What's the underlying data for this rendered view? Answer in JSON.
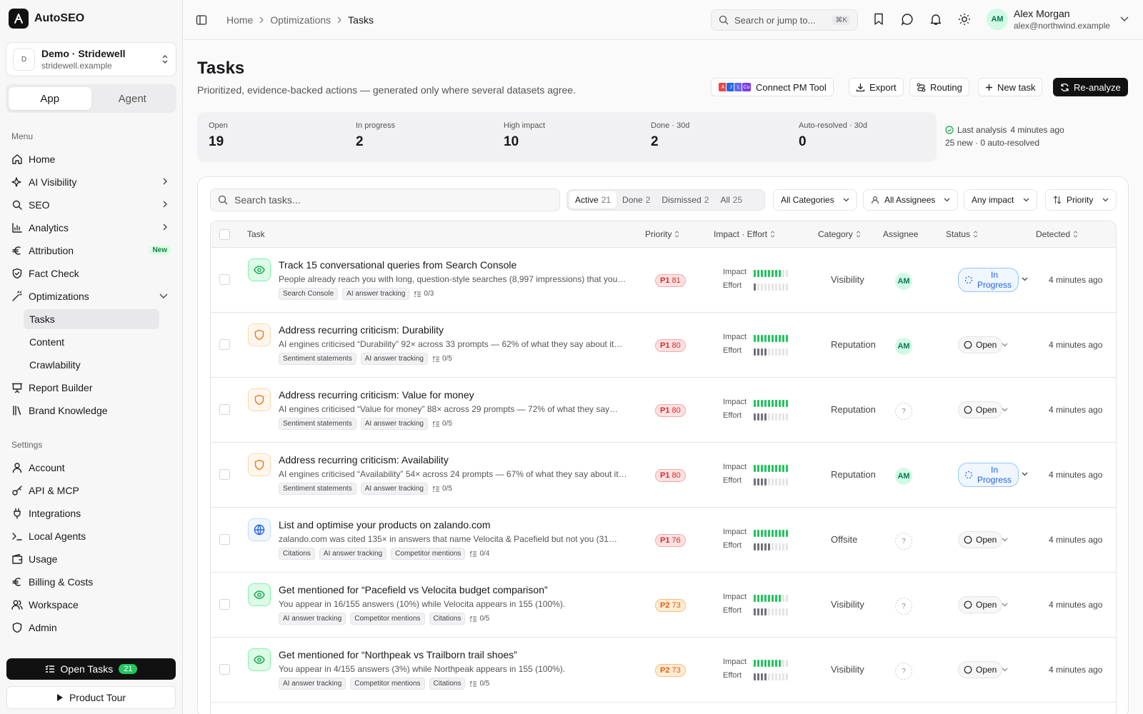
{
  "app": {
    "name": "AutoSEO"
  },
  "workspace": {
    "initial": "D",
    "name": "Demo · Stridewell",
    "domain": "stridewell.example"
  },
  "mode_tabs": {
    "app": "App",
    "agent": "Agent"
  },
  "sidebar": {
    "menu_label": "Menu",
    "items": [
      {
        "label": "Home",
        "icon": "home-icon"
      },
      {
        "label": "AI Visibility",
        "icon": "sparkles-icon",
        "chevron": true
      },
      {
        "label": "SEO",
        "icon": "search-icon",
        "chevron": true
      },
      {
        "label": "Analytics",
        "icon": "bar-chart-icon",
        "chevron": true
      },
      {
        "label": "Attribution",
        "icon": "euro-icon",
        "badge": "New"
      },
      {
        "label": "Fact Check",
        "icon": "shield-check-icon"
      },
      {
        "label": "Optimizations",
        "icon": "magic-wand-icon",
        "expanded": true
      }
    ],
    "sub_items": [
      "Tasks",
      "Content",
      "Crawlability"
    ],
    "items2": [
      {
        "label": "Report Builder",
        "icon": "presentation-icon"
      },
      {
        "label": "Brand Knowledge",
        "icon": "library-icon"
      }
    ],
    "settings_label": "Settings",
    "settings": [
      {
        "label": "Account",
        "icon": "user-icon"
      },
      {
        "label": "API & MCP",
        "icon": "key-icon"
      },
      {
        "label": "Integrations",
        "icon": "plug-icon"
      },
      {
        "label": "Local Agents",
        "icon": "terminal-icon"
      },
      {
        "label": "Usage",
        "icon": "wallet-icon"
      },
      {
        "label": "Billing & Costs",
        "icon": "euro-icon"
      },
      {
        "label": "Workspace",
        "icon": "users-icon"
      },
      {
        "label": "Admin",
        "icon": "shield-icon"
      }
    ],
    "open_tasks": {
      "label": "Open Tasks",
      "count": "21"
    },
    "product_tour": "Product Tour"
  },
  "topbar": {
    "breadcrumb": [
      "Home",
      "Optimizations",
      "Tasks"
    ],
    "search_placeholder": "Search or jump to...",
    "shortcut": "⌘K",
    "user": {
      "initials": "AM",
      "name": "Alex Morgan",
      "email": "alex@northwind.example"
    }
  },
  "page": {
    "title": "Tasks",
    "subtitle": "Prioritized, evidence-backed actions — generated only where several datasets agree.",
    "actions": {
      "connect": "Connect PM Tool",
      "export": "Export",
      "routing": "Routing",
      "new_task": "New task",
      "reanalyze": "Re-analyze"
    },
    "pm_tools": [
      "A",
      "J",
      "L",
      "Cu"
    ]
  },
  "stats": [
    {
      "label": "Open",
      "value": "19"
    },
    {
      "label": "In progress",
      "value": "2"
    },
    {
      "label": "High impact",
      "value": "10"
    },
    {
      "label": "Done · 30d",
      "value": "2"
    },
    {
      "label": "Auto-resolved · 30d",
      "value": "0"
    }
  ],
  "last_analysis": {
    "label": "Last analysis",
    "time": "4 minutes ago",
    "summary": "25 new · 0 auto-resolved"
  },
  "filters": {
    "search_placeholder": "Search tasks...",
    "tabs": [
      {
        "label": "Active",
        "count": "21"
      },
      {
        "label": "Done",
        "count": "2"
      },
      {
        "label": "Dismissed",
        "count": "2"
      },
      {
        "label": "All",
        "count": "25"
      }
    ],
    "category": "All Categories",
    "assignee": "All Assignees",
    "impact": "Any impact",
    "sort": "Priority"
  },
  "table": {
    "columns": {
      "task": "Task",
      "priority": "Priority",
      "impact_effort": "Impact · Effort",
      "category": "Category",
      "assignee": "Assignee",
      "status": "Status",
      "detected": "Detected"
    },
    "impact_label": "Impact",
    "effort_label": "Effort",
    "rows": [
      {
        "icon": "eye-icon",
        "tone": "green",
        "title": "Track 15 conversational queries from Search Console",
        "desc": "People already reach you with long, question-style searches (8,997 impressions) that you…",
        "tags": [
          "Search Console",
          "AI answer tracking"
        ],
        "subtasks": "0/3",
        "priority": "P1",
        "score": "81",
        "impact": 8,
        "effort": 1,
        "category": "Visibility",
        "assignee": "AM",
        "status": "In Progress",
        "detected": "4 minutes ago"
      },
      {
        "icon": "shield-icon",
        "tone": "orange",
        "title": "Address recurring criticism: Durability",
        "desc": "AI engines criticised “Durability” 92× across 33 prompts — 62% of what they say about it…",
        "tags": [
          "Sentiment statements",
          "AI answer tracking"
        ],
        "subtasks": "0/5",
        "priority": "P1",
        "score": "80",
        "impact": 10,
        "effort": 4,
        "category": "Reputation",
        "assignee": "AM",
        "status": "Open",
        "detected": "4 minutes ago"
      },
      {
        "icon": "shield-icon",
        "tone": "orange",
        "title": "Address recurring criticism: Value for money",
        "desc": "AI engines criticised “Value for money” 88× across 29 prompts — 72% of what they say…",
        "tags": [
          "Sentiment statements",
          "AI answer tracking"
        ],
        "subtasks": "0/5",
        "priority": "P1",
        "score": "80",
        "impact": 10,
        "effort": 4,
        "category": "Reputation",
        "assignee": "?",
        "status": "Open",
        "detected": "4 minutes ago"
      },
      {
        "icon": "shield-icon",
        "tone": "orange",
        "title": "Address recurring criticism: Availability",
        "desc": "AI engines criticised “Availability” 54× across 24 prompts — 67% of what they say about it…",
        "tags": [
          "Sentiment statements",
          "AI answer tracking"
        ],
        "subtasks": "0/5",
        "priority": "P1",
        "score": "80",
        "impact": 10,
        "effort": 4,
        "category": "Reputation",
        "assignee": "AM",
        "status": "In Progress",
        "detected": "4 minutes ago"
      },
      {
        "icon": "globe-icon",
        "tone": "blue",
        "title": "List and optimise your products on zalando.com",
        "desc": "zalando.com was cited 135× in answers that name Velocita & Pacefield but not you (31…",
        "tags": [
          "Citations",
          "AI answer tracking",
          "Competitor mentions"
        ],
        "subtasks": "0/4",
        "priority": "P1",
        "score": "76",
        "impact": 10,
        "effort": 5,
        "category": "Offsite",
        "assignee": "?",
        "status": "Open",
        "detected": "4 minutes ago"
      },
      {
        "icon": "eye-icon",
        "tone": "green",
        "title": "Get mentioned for “Pacefield vs Velocita budget comparison”",
        "desc": "You appear in 16/155 answers (10%) while Velocita appears in 155 (100%).",
        "tags": [
          "AI answer tracking",
          "Competitor mentions",
          "Citations"
        ],
        "subtasks": "0/5",
        "priority": "P2",
        "score": "73",
        "impact": 8,
        "effort": 4,
        "category": "Visibility",
        "assignee": "?",
        "status": "Open",
        "detected": "4 minutes ago"
      },
      {
        "icon": "eye-icon",
        "tone": "green",
        "title": "Get mentioned for “Northpeak vs Trailborn trail shoes”",
        "desc": "You appear in 4/155 answers (3%) while Northpeak appears in 155 (100%).",
        "tags": [
          "AI answer tracking",
          "Competitor mentions",
          "Citations"
        ],
        "subtasks": "0/5",
        "priority": "P2",
        "score": "73",
        "impact": 8,
        "effort": 4,
        "category": "Visibility",
        "assignee": "?",
        "status": "Open",
        "detected": "4 minutes ago"
      }
    ]
  }
}
